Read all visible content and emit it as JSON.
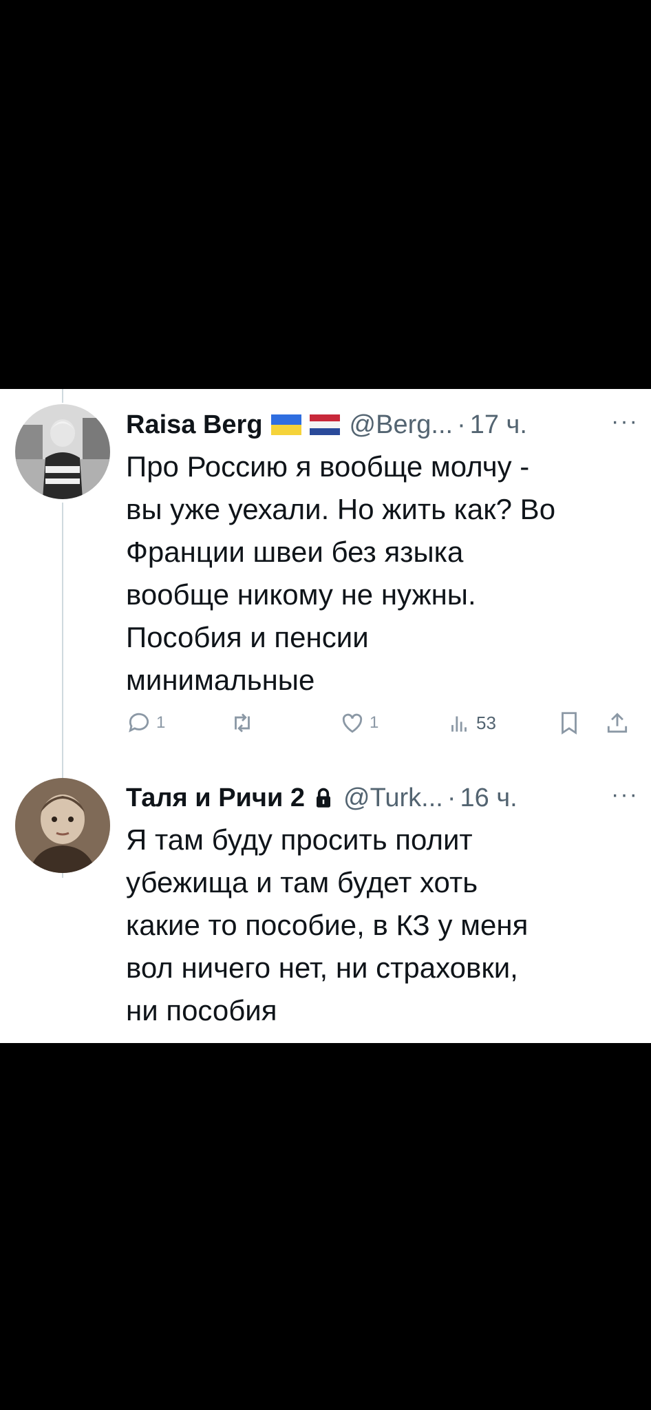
{
  "tweets": [
    {
      "name": "Raisa Berg",
      "flags": [
        "ukraine-flag",
        "netherlands-flag"
      ],
      "handle": "@Berg...",
      "separator": "·",
      "time": "17 ч.",
      "more": "···",
      "text": "Про Россию я вообще молчу -\nвы уже уехали. Но жить как? Во\nФранции швеи без языка\nвообще никому не нужны.\nПособия и пенсии\nминимальные",
      "actions": {
        "reply_icon": "reply-icon",
        "reply_count": "1",
        "retweet_icon": "retweet-icon",
        "retweet_count": "",
        "like_icon": "heart-icon",
        "like_count": "1",
        "views_icon": "views-icon",
        "views_count": "53",
        "bookmark_icon": "bookmark-icon",
        "share_icon": "share-icon"
      }
    },
    {
      "name": "Таля и Ричи 2",
      "lock_icon": "lock-icon",
      "handle": "@Turk...",
      "separator": "·",
      "time": "16 ч.",
      "more": "···",
      "text": "Я там буду просить полит\nубежища и там будет хоть\nкакие то пособие, в КЗ у меня\nвол ничего нет, ни страховки,\nни пособия"
    }
  ],
  "colors": {
    "text": "#0f1419",
    "secondary": "#536471",
    "icons": "#8b98a5",
    "thread_line": "#cfd9de",
    "background_outer": "#000000",
    "card": "#ffffff"
  }
}
